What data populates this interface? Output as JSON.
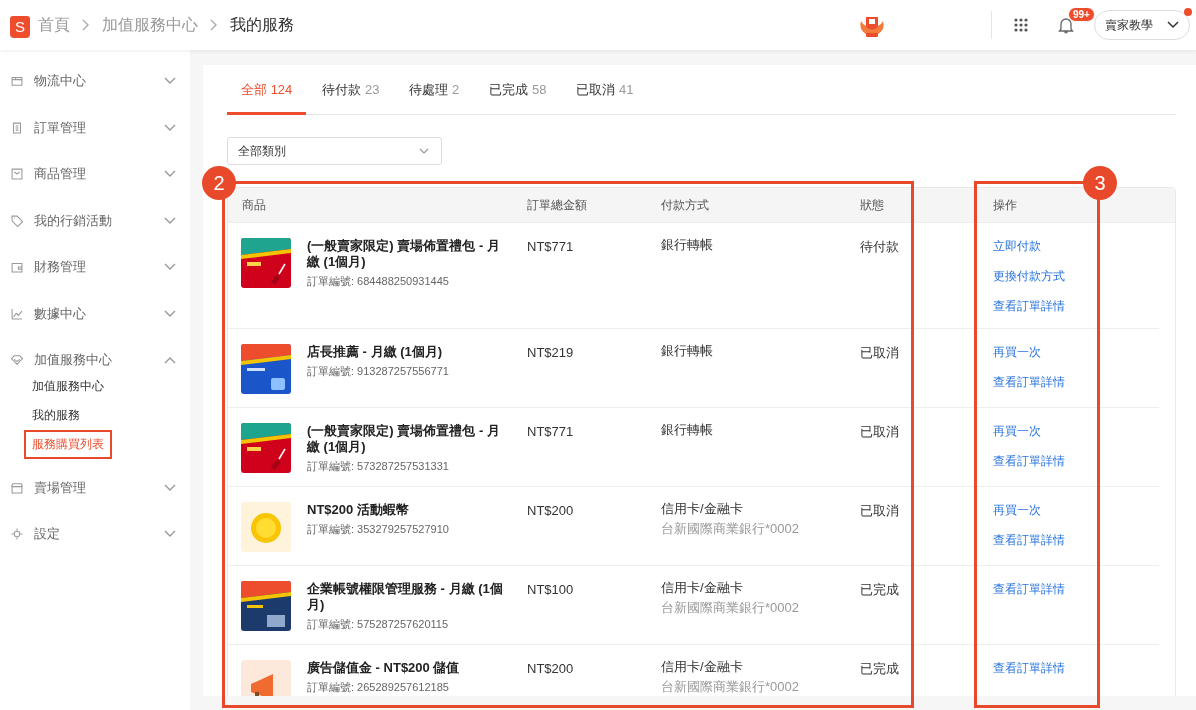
{
  "header": {
    "logo_text": "S",
    "breadcrumb": [
      {
        "text": "首頁"
      },
      {
        "text": "加值服務中心"
      },
      {
        "text": "我的服務"
      }
    ],
    "notification_count": "99+",
    "help_button": {
      "label": "賣家教學",
      "has_dot": true
    }
  },
  "sidebar": {
    "items": [
      {
        "label": "物流中心",
        "expanded": false
      },
      {
        "label": "訂單管理",
        "expanded": false
      },
      {
        "label": "商品管理",
        "expanded": false
      },
      {
        "label": "我的行銷活動",
        "expanded": false
      },
      {
        "label": "財務管理",
        "expanded": false
      },
      {
        "label": "數據中心",
        "expanded": false
      },
      {
        "label": "加值服務中心",
        "expanded": true,
        "children": [
          {
            "label": "加值服務中心",
            "selected": false,
            "boxed": false
          },
          {
            "label": "我的服務",
            "selected": false,
            "boxed": false
          },
          {
            "label": "服務購買列表",
            "selected": true,
            "boxed": true
          }
        ]
      },
      {
        "label": "賣場管理",
        "expanded": false
      },
      {
        "label": "設定",
        "expanded": false
      }
    ]
  },
  "tabs": [
    {
      "label": "全部",
      "count": "124",
      "selected": true
    },
    {
      "label": "待付款",
      "count": "23",
      "selected": false
    },
    {
      "label": "待處理",
      "count": "2",
      "selected": false
    },
    {
      "label": "已完成",
      "count": "58",
      "selected": false
    },
    {
      "label": "已取消",
      "count": "41",
      "selected": false
    }
  ],
  "filter": {
    "value": "全部類別"
  },
  "table": {
    "columns": [
      "商品",
      "訂單總金額",
      "付款方式",
      "狀態",
      "操作"
    ],
    "rows": [
      {
        "thumbnail": {
          "kind": "picture"
        },
        "name": "(一般賣家限定) 賣場佈置禮包 - 月繳 (1個月)",
        "order_no": "訂單編號: 684488250931445",
        "amount": "NT$771",
        "payment": "銀行轉帳",
        "status": "待付款",
        "actions": [
          "立即付款",
          "更換付款方式",
          "查看訂單詳情"
        ]
      },
      {
        "thumbnail": {
          "kind": "picture"
        },
        "name": "店長推薦 - 月繳 (1個月)",
        "order_no": "訂單編號: 913287257556771",
        "amount": "NT$219",
        "payment": "銀行轉帳",
        "status": "已取消",
        "actions": [
          "再買一次",
          "查看訂單詳情"
        ]
      },
      {
        "thumbnail": {
          "kind": "picture"
        },
        "name": "(一般賣家限定) 賣場佈置禮包 - 月繳 (1個月)",
        "order_no": "訂單編號: 573287257531331",
        "amount": "NT$771",
        "payment": "銀行轉帳",
        "status": "已取消",
        "actions": [
          "再買一次",
          "查看訂單詳情"
        ]
      },
      {
        "thumbnail": {
          "kind": "picture"
        },
        "name": "NT$200 活動蝦幣",
        "order_no": "訂單編號: 353279257527910",
        "amount": "NT$200",
        "payment": "信用卡/金融卡",
        "payment_detail": "台新國際商業銀行*0002",
        "status": "已取消",
        "actions": [
          "再買一次",
          "查看訂單詳情"
        ]
      },
      {
        "thumbnail": {
          "kind": "picture"
        },
        "name": "企業帳號權限管理服務 - 月繳 (1個月)",
        "order_no": "訂單編號: 575287257620115",
        "amount": "NT$100",
        "payment": "信用卡/金融卡",
        "payment_detail": "台新國際商業銀行*0002",
        "status": "已完成",
        "actions": [
          "查看訂單詳情"
        ]
      },
      {
        "thumbnail": {
          "kind": "picture"
        },
        "name": "廣告儲值金 - NT$200 儲值",
        "order_no": "訂單編號: 265289257612185",
        "amount": "NT$200",
        "payment": "信用卡/金融卡",
        "payment_detail": "台新國際商業銀行*0002",
        "status": "已完成",
        "actions": [
          "查看訂單詳情"
        ]
      }
    ]
  },
  "annotations": [
    {
      "label": "2"
    },
    {
      "label": "3"
    }
  ]
}
